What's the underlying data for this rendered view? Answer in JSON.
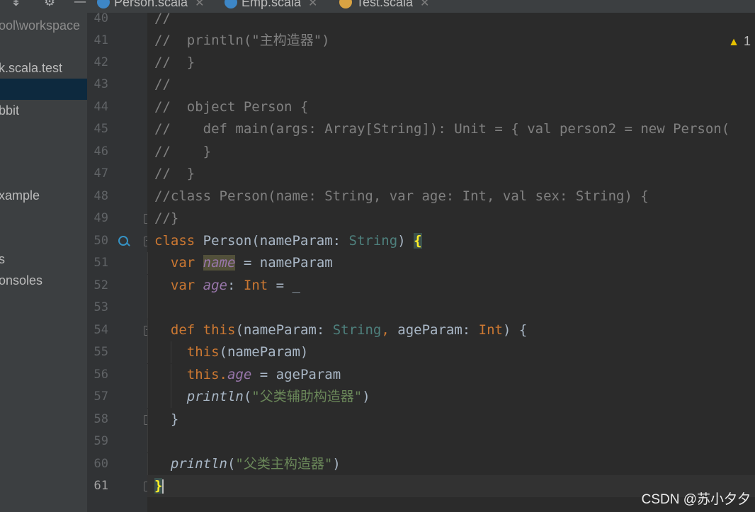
{
  "sidebar": {
    "path_fragment": "ool\\workspace",
    "items": [
      {
        "label": "k.scala.test"
      },
      {
        "label": ""
      },
      {
        "label": "bbit"
      },
      {
        "label": "xample"
      },
      {
        "label": "s"
      },
      {
        "label": "onsoles"
      }
    ]
  },
  "tabs": [
    {
      "label": "Person.scala",
      "icon": "scala-class-icon",
      "active": true
    },
    {
      "label": "Emp.scala",
      "icon": "scala-class-icon",
      "active": false
    },
    {
      "label": "Test.scala",
      "icon": "scala-object-icon",
      "active": false
    }
  ],
  "editor": {
    "line_numbers": [
      "40",
      "41",
      "42",
      "43",
      "44",
      "45",
      "46",
      "47",
      "48",
      "49",
      "50",
      "51",
      "52",
      "53",
      "54",
      "55",
      "56",
      "57",
      "58",
      "59",
      "60",
      "61"
    ],
    "code": {
      "l40": "//",
      "l41": "//  println(\"主构造器\")",
      "l42": "//  }",
      "l43": "//",
      "l44": "//  object Person {",
      "l45": "//    def main(args: Array[String]): Unit = { val person2 = new Person(",
      "l46": "//    }",
      "l47": "//  }",
      "l48": "//class Person(name: String, var age: Int, val sex: String) {",
      "l49": "//}",
      "kw_class": "class",
      "name_Person": " Person(nameParam: ",
      "type_String": "String",
      "paren_close": ") ",
      "brace_open": "{",
      "kw_var": "var",
      "field_name": "name",
      "assign_nameParam": " = nameParam",
      "field_age": "age",
      "colon": ": ",
      "type_Int": "Int",
      "assign_default": " = _",
      "kw_def": "def",
      "kw_this": "this",
      "def_sig_1": "(nameParam: ",
      "comma": ", ",
      "def_sig_2": "ageParam: ",
      "def_sig_3": ") {",
      "this_call": "(nameParam)",
      "dot": ".",
      "assign_ageParam": " = ageParam",
      "fn_println": "println",
      "paren_open": "(",
      "str_aux": "\"父类辅助构造器\"",
      "paren_end": ")",
      "brace_close": "}",
      "str_primary": "\"父类主构造器\""
    },
    "current_line": "61"
  },
  "status": {
    "warning_count": "1"
  },
  "watermark": "CSDN @苏小夕夕"
}
